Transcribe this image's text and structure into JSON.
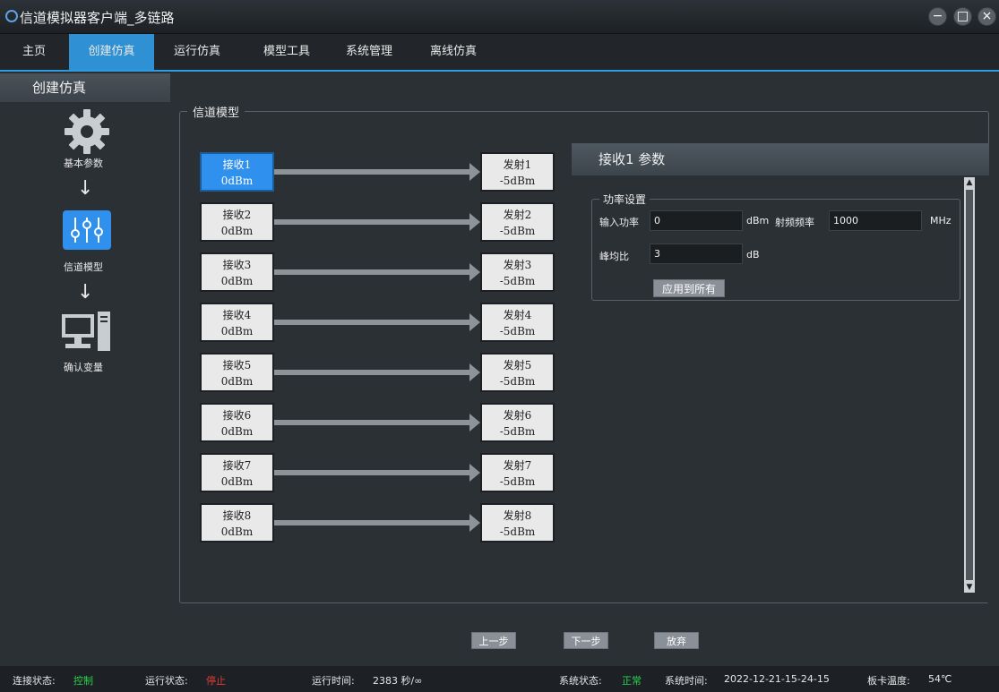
{
  "window": {
    "title": "信道模拟器客户端_多链路"
  },
  "menu": [
    {
      "label": "主页",
      "active": false
    },
    {
      "label": "创建仿真",
      "active": true
    },
    {
      "label": "运行仿真",
      "active": false
    },
    {
      "label": "模型工具",
      "active": false
    },
    {
      "label": "系统管理",
      "active": false
    },
    {
      "label": "离线仿真",
      "active": false
    }
  ],
  "sidebar": {
    "title": "创建仿真",
    "steps": [
      {
        "label": "基本参数",
        "icon": "gear-icon"
      },
      {
        "label": "信道模型",
        "icon": "sliders-icon"
      },
      {
        "label": "确认变量",
        "icon": "computer-icon"
      }
    ]
  },
  "channel_model": {
    "group_title": "信道模型",
    "receivers": [
      {
        "name": "接收1",
        "value": "0dBm"
      },
      {
        "name": "接收2",
        "value": "0dBm"
      },
      {
        "name": "接收3",
        "value": "0dBm"
      },
      {
        "name": "接收4",
        "value": "0dBm"
      },
      {
        "name": "接收5",
        "value": "0dBm"
      },
      {
        "name": "接收6",
        "value": "0dBm"
      },
      {
        "name": "接收7",
        "value": "0dBm"
      },
      {
        "name": "接收8",
        "value": "0dBm"
      }
    ],
    "transmitters": [
      {
        "name": "发射1",
        "value": "-5dBm"
      },
      {
        "name": "发射2",
        "value": "-5dBm"
      },
      {
        "name": "发射3",
        "value": "-5dBm"
      },
      {
        "name": "发射4",
        "value": "-5dBm"
      },
      {
        "name": "发射5",
        "value": "-5dBm"
      },
      {
        "name": "发射6",
        "value": "-5dBm"
      },
      {
        "name": "发射7",
        "value": "-5dBm"
      },
      {
        "name": "发射8",
        "value": "-5dBm"
      }
    ]
  },
  "params": {
    "header": "接收1 参数",
    "power_group_title": "功率设置",
    "input_power_label": "输入功率",
    "input_power_value": "0",
    "input_power_unit": "dBm",
    "rf_freq_label": "射频频率",
    "rf_freq_value": "1000",
    "rf_freq_unit": "MHz",
    "papr_label": "峰均比",
    "papr_value": "3",
    "papr_unit": "dB",
    "apply_all_label": "应用到所有"
  },
  "nav": {
    "prev": "上一步",
    "next": "下一步",
    "discard": "放弃"
  },
  "status": {
    "connection_label": "连接状态:",
    "connection_value": "控制",
    "run_label": "运行状态:",
    "run_value": "停止",
    "run_time_label": "运行时间:",
    "run_time_value": "2383 秒/∞",
    "system_label": "系统状态:",
    "system_value": "正常",
    "system_time_label": "系统时间:",
    "system_time_value": "2022-12-21-15-24-15",
    "board_temp_label": "板卡温度:",
    "board_temp_value": "54℃"
  },
  "colors": {
    "accent": "#2f90d3",
    "selected_box": "#2f90ee",
    "status_ok": "#2bd24a",
    "status_stop": "#e53935"
  }
}
